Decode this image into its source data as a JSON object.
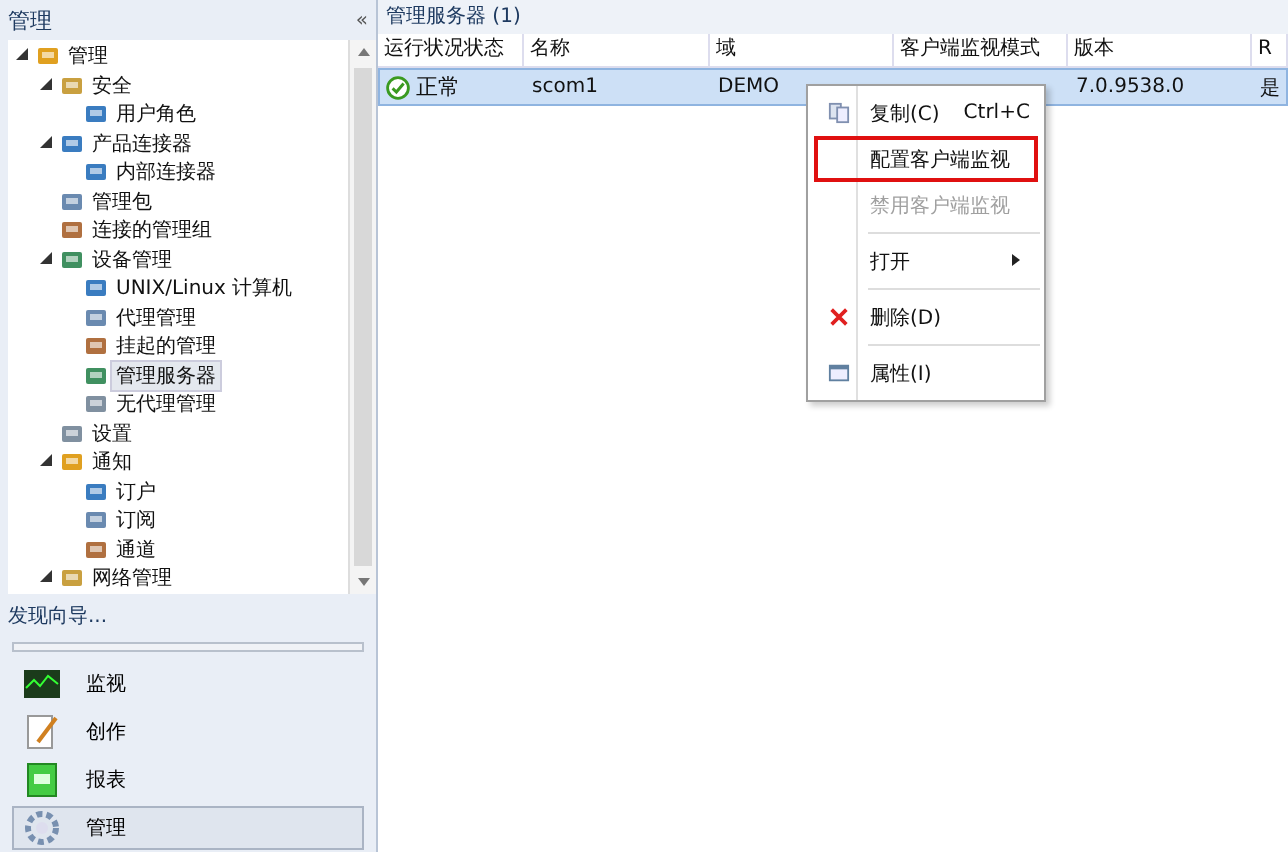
{
  "left_pane": {
    "title": "管理",
    "collapse_glyph": "«"
  },
  "tree": [
    {
      "label": "管理",
      "expanded": true,
      "selected": false,
      "children": [
        {
          "label": "安全",
          "expanded": true,
          "selected": false,
          "children": [
            {
              "label": "用户角色",
              "selected": false
            }
          ]
        },
        {
          "label": "产品连接器",
          "expanded": true,
          "selected": false,
          "children": [
            {
              "label": "内部连接器",
              "selected": false
            }
          ]
        },
        {
          "label": "管理包",
          "selected": false
        },
        {
          "label": "连接的管理组",
          "selected": false
        },
        {
          "label": "设备管理",
          "expanded": true,
          "selected": false,
          "children": [
            {
              "label": "UNIX/Linux 计算机",
              "selected": false
            },
            {
              "label": "代理管理",
              "selected": false
            },
            {
              "label": "挂起的管理",
              "selected": false
            },
            {
              "label": "管理服务器",
              "selected": true
            },
            {
              "label": "无代理管理",
              "selected": false
            }
          ]
        },
        {
          "label": "设置",
          "selected": false
        },
        {
          "label": "通知",
          "expanded": true,
          "selected": false,
          "children": [
            {
              "label": "订户",
              "selected": false
            },
            {
              "label": "订阅",
              "selected": false
            },
            {
              "label": "通道",
              "selected": false
            }
          ]
        },
        {
          "label": "网络管理",
          "expanded": true,
          "selected": false
        }
      ]
    }
  ],
  "discovery_link": "发现向导...",
  "nav": [
    {
      "label": "监视",
      "selected": false
    },
    {
      "label": "创作",
      "selected": false
    },
    {
      "label": "报表",
      "selected": false
    },
    {
      "label": "管理",
      "selected": true
    }
  ],
  "content": {
    "title": "管理服务器 (1)"
  },
  "table": {
    "columns": [
      "运行状况状态",
      "名称",
      "域",
      "客户端监视模式",
      "版本",
      "R"
    ],
    "rows": [
      {
        "selected": true,
        "cells": [
          "正常",
          "scom1",
          "DEMO",
          null,
          "7.0.9538.0",
          "是"
        ]
      }
    ]
  },
  "context_menu": [
    {
      "kind": "item",
      "label": "复制(C)",
      "shortcut": "Ctrl+C",
      "disabled": false,
      "outlined": false
    },
    {
      "kind": "item",
      "label": "配置客户端监视",
      "disabled": false,
      "outlined": true
    },
    {
      "kind": "item",
      "label": "禁用客户端监视",
      "disabled": true,
      "outlined": false
    },
    {
      "kind": "separator"
    },
    {
      "kind": "item",
      "label": "打开",
      "submenu": true,
      "disabled": false,
      "outlined": false
    },
    {
      "kind": "separator"
    },
    {
      "kind": "item",
      "label": "删除(D)",
      "disabled": false,
      "outlined": false
    },
    {
      "kind": "separator"
    },
    {
      "kind": "item",
      "label": "属性(I)",
      "disabled": false,
      "outlined": false
    }
  ]
}
